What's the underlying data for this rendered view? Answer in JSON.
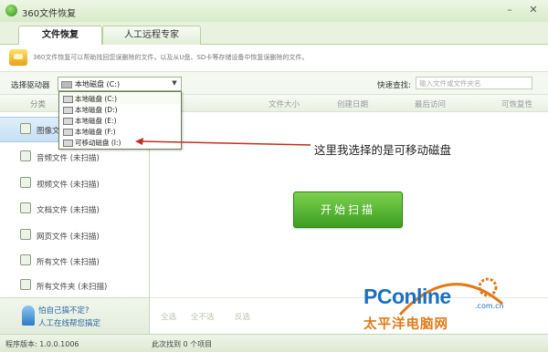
{
  "window": {
    "title": "360文件恢复",
    "minimize_symbol": "–",
    "close_symbol": "✕"
  },
  "tabs": [
    {
      "label": "文件恢复"
    },
    {
      "label": "人工远程专家"
    }
  ],
  "info": {
    "text": "360文件恢复可以帮助找回您误删除的文件，以及从U盘、SD卡等存储设备中恢复误删除的文件。"
  },
  "toolbar": {
    "drive_label": "选择驱动器",
    "drive_selected": "本地磁盘 (C:)",
    "quick_search_label": "快速查找:",
    "quick_search_placeholder": "输入文件或文件夹名"
  },
  "drive_options": [
    {
      "label": "本地磁盘 (C:)"
    },
    {
      "label": "本地磁盘 (D:)"
    },
    {
      "label": "本地磁盘 (E:)"
    },
    {
      "label": "本地磁盘 (F:)"
    },
    {
      "label": "可移动磁盘 (I:)"
    }
  ],
  "sidebar": {
    "header": "分类",
    "items": [
      {
        "label": "图像文件 (未扫描)"
      },
      {
        "label": "音频文件 (未扫描)"
      },
      {
        "label": "视频文件 (未扫描)"
      },
      {
        "label": "文档文件 (未扫描)"
      },
      {
        "label": "网页文件 (未扫描)"
      },
      {
        "label": "所有文件 (未扫描)"
      },
      {
        "label": "所有文件夹 (未扫描)"
      }
    ],
    "help_title": "怕自己搞不定?",
    "help_sub": "人工在线帮您搞定"
  },
  "columns": [
    "文件大小",
    "创建日期",
    "最后访问",
    "可恢复性"
  ],
  "scan_button": "开始扫描",
  "annotation": "这里我选择的是可移动磁盘",
  "footer_actions": [
    "全选",
    "全不选",
    "反选"
  ],
  "status": {
    "version": "程序版本: 1.0.0.1006",
    "found": "此次找到 0 个项目"
  },
  "watermark": {
    "brand_a": "PC",
    "brand_b": "online",
    "domain": ".com.cn",
    "cn": "太平洋电脑网"
  },
  "colors": {
    "accent": "#3d9e20",
    "brand_blue": "#1b6fc0",
    "brand_orange": "#e07a1a",
    "annotation_arrow": "#c0301e"
  }
}
